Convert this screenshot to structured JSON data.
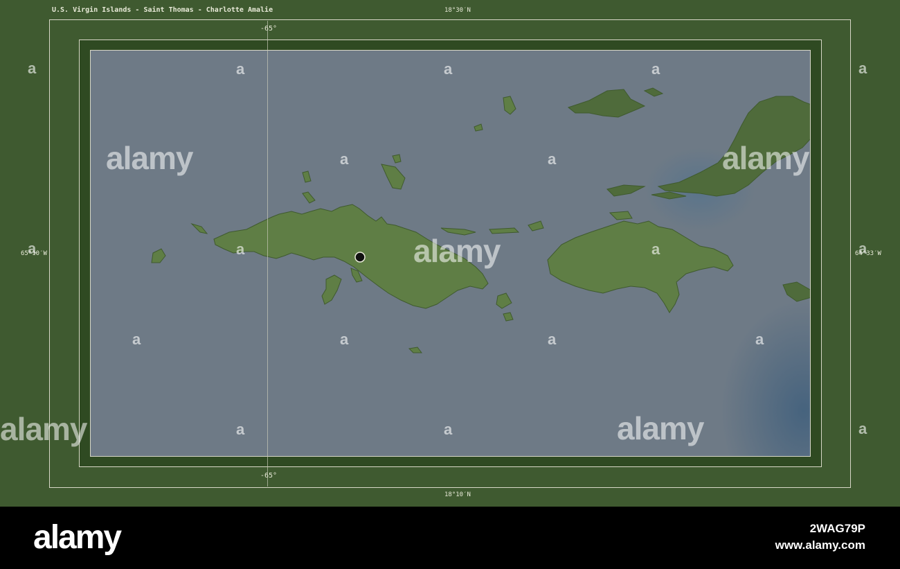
{
  "map": {
    "title": "U.S. Virgin Islands - Saint Thomas - Charlotte Amalie",
    "lat_top": "18°30′N",
    "lat_bottom": "18°10′N",
    "lon_left": "65°10′W",
    "lon_right": "64°33′W",
    "gridline_top": "-65°",
    "gridline_bottom": "-65°",
    "marker": "Charlotte Amalie",
    "colors": {
      "land": "#5f7e45",
      "land_dark": "#465f33",
      "sea": "#6e7a86",
      "frame": "#3f5a30"
    }
  },
  "watermark": {
    "word": "alamy",
    "letter": "a"
  },
  "footer": {
    "logo": "alamy",
    "image_code": "2WAG79P",
    "url": "www.alamy.com"
  }
}
